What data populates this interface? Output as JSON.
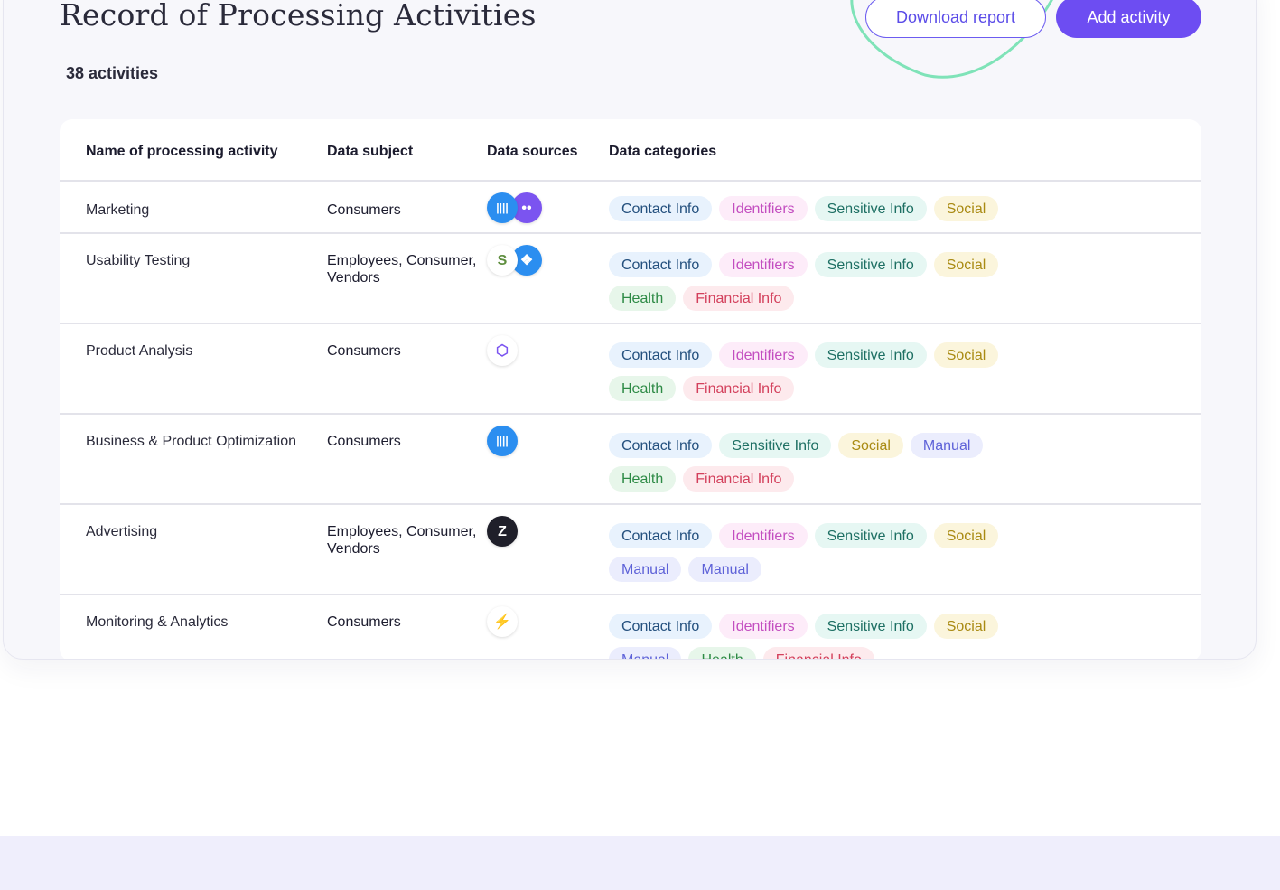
{
  "header": {
    "title": "Record of Processing Activities",
    "count": "38 activities",
    "download_label": "Download report",
    "add_label": "Add activity"
  },
  "colors": {
    "accent": "#6d4df2",
    "highlight_stroke": "#7fe3b8"
  },
  "table": {
    "columns": [
      "Name of processing activity",
      "Data subject",
      "Data sources",
      "Data categories"
    ],
    "rows": [
      {
        "name": "Marketing",
        "subject": "Consumers",
        "sources": [
          {
            "icon": "intercom-icon",
            "glyph": "||||",
            "bg": "#2b8ef0"
          },
          {
            "icon": "chat-icon",
            "glyph": "••",
            "bg": "#7b54f0"
          }
        ],
        "categories": [
          "Contact Info",
          "Identifiers",
          "Sensitive Info",
          "Social"
        ]
      },
      {
        "name": "Usability Testing",
        "subject": "Employees, Consumer, Vendors",
        "sources": [
          {
            "icon": "shopify-icon",
            "glyph": "S",
            "bg": "#ffffff"
          },
          {
            "icon": "dropbox-icon",
            "glyph": "❖",
            "bg": "#2b8ef0"
          }
        ],
        "categories": [
          "Contact Info",
          "Identifiers",
          "Sensitive Info",
          "Social",
          "Health",
          "Financial Info"
        ]
      },
      {
        "name": "Product Analysis",
        "subject": "Consumers",
        "sources": [
          {
            "icon": "cube-icon",
            "glyph": "⬡",
            "bg": "#ffffff"
          }
        ],
        "categories": [
          "Contact Info",
          "Identifiers",
          "Sensitive Info",
          "Social",
          "Health",
          "Financial Info"
        ]
      },
      {
        "name": "Business & Product Optimization",
        "subject": "Consumers",
        "sources": [
          {
            "icon": "intercom-icon",
            "glyph": "||||",
            "bg": "#2b8ef0"
          }
        ],
        "categories": [
          "Contact Info",
          "Sensitive Info",
          "Social",
          "Manual",
          "Health",
          "Financial Info"
        ]
      },
      {
        "name": "Advertising",
        "subject": "Employees, Consumer, Vendors",
        "sources": [
          {
            "icon": "zendesk-icon",
            "glyph": "Z",
            "bg": "#1f1f2a"
          }
        ],
        "categories": [
          "Contact Info",
          "Identifiers",
          "Sensitive Info",
          "Social",
          "Manual",
          "Manual"
        ]
      },
      {
        "name": "Monitoring & Analytics",
        "subject": "Consumers",
        "sources": [
          {
            "icon": "zapier-icon",
            "glyph": "⚡",
            "bg": "#ffffff"
          }
        ],
        "categories": [
          "Contact Info",
          "Identifiers",
          "Sensitive Info",
          "Social",
          "Manual",
          "Health",
          "Financial Info"
        ]
      }
    ]
  },
  "chip_styles": {
    "Contact Info": {
      "bg": "#e8f2fd",
      "fg": "#24507e"
    },
    "Identifiers": {
      "bg": "#fdecf9",
      "fg": "#c34ec0"
    },
    "Sensitive Info": {
      "bg": "#e6f7f3",
      "fg": "#1d6f63"
    },
    "Social": {
      "bg": "#fbf5dc",
      "fg": "#a98a12"
    },
    "Health": {
      "bg": "#e7f6ea",
      "fg": "#2d8a45"
    },
    "Financial Info": {
      "bg": "#fdeaed",
      "fg": "#d3405c"
    },
    "Manual": {
      "bg": "#ebedfd",
      "fg": "#5e62d8"
    }
  }
}
